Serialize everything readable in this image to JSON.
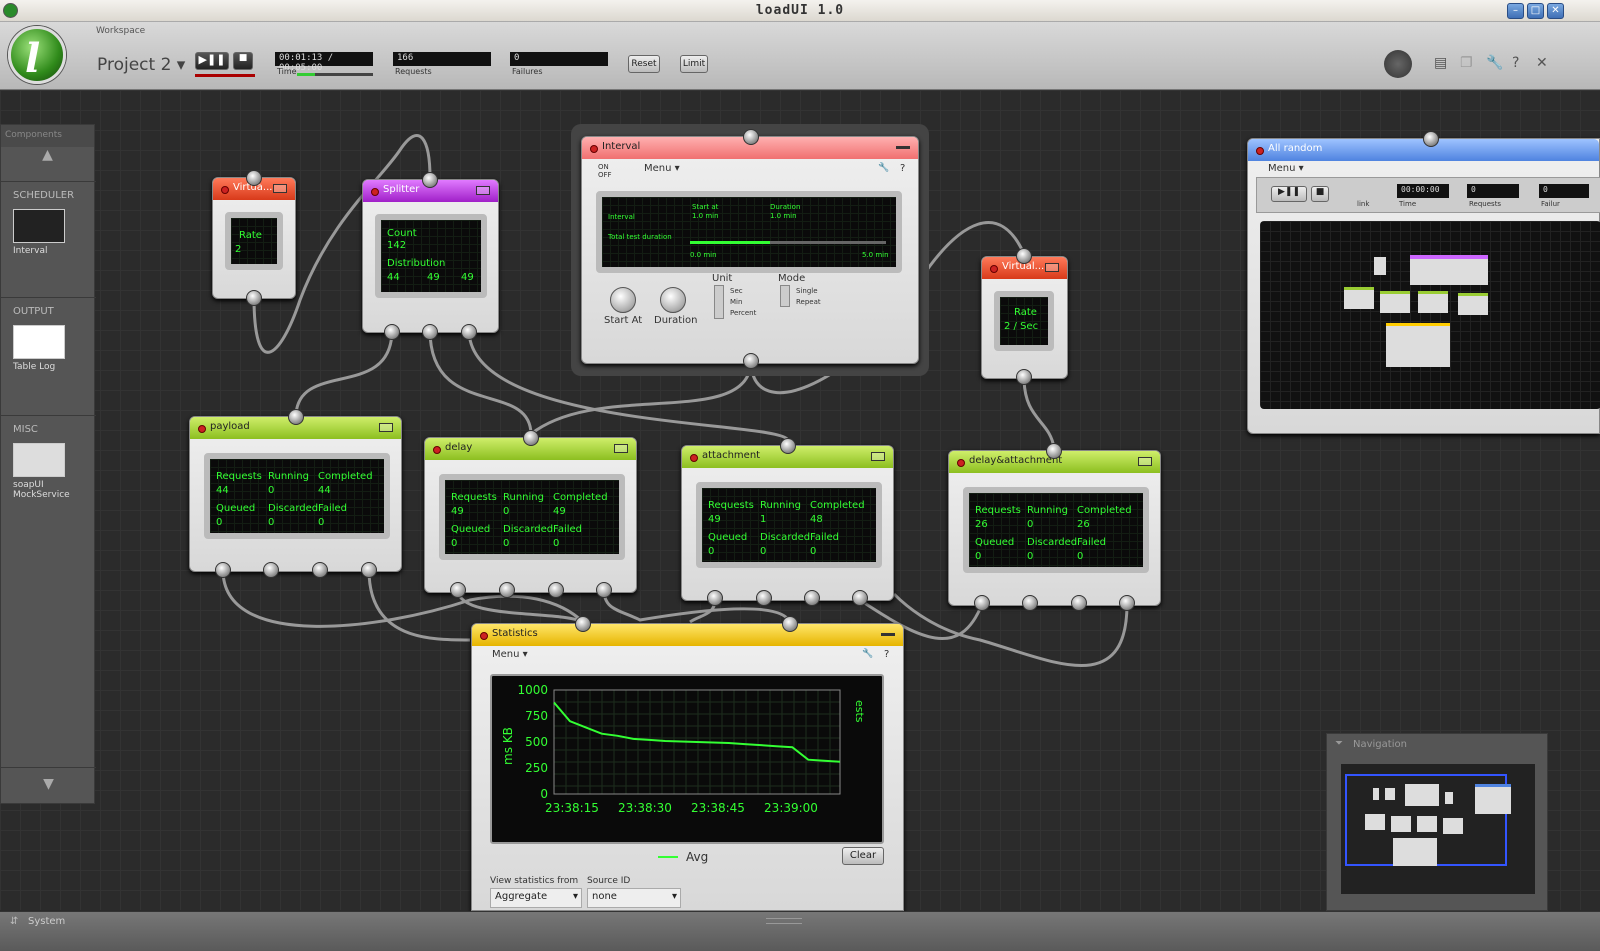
{
  "app": {
    "title": "loadUI 1.0",
    "workspace_label": "Workspace",
    "project_name": "Project 2"
  },
  "toolbar": {
    "time_value": "00:01:13 / 00:05:00",
    "time_label": "Time",
    "requests_value": "166",
    "requests_label": "Requests",
    "failures_value": "0",
    "failures_label": "Failures",
    "reset_label": "Reset",
    "limit_label": "Limit",
    "time_progress": 0.24
  },
  "sidebar": {
    "header": "Components",
    "sections": [
      {
        "title": "SCHEDULER",
        "item": "Interval"
      },
      {
        "title": "OUTPUT",
        "item": "Table Log"
      },
      {
        "title": "MISC",
        "item": "soapUI MockService"
      }
    ]
  },
  "nodes": {
    "virtual1": {
      "title": "Virtua...",
      "rate_label": "Rate",
      "rate_value": "2"
    },
    "splitter": {
      "title": "Splitter",
      "count_label": "Count",
      "count_value": "142",
      "dist_label": "Distribution",
      "d1": "44",
      "d2": "49",
      "d3": "49"
    },
    "interval": {
      "title": "Interval",
      "on": "ON",
      "off": "OFF",
      "menu": "Menu",
      "screen_interval": "Interval",
      "start_at_label": "Start at",
      "start_at_value": "1.0 min",
      "duration_label": "Duration",
      "duration_value": "1.0 min",
      "total_label": "Total test duration",
      "min_label": "0.0 min",
      "max_label": "5.0 min",
      "knob1": "Start At",
      "knob2": "Duration",
      "unit_label": "Unit",
      "unit_opts": [
        "Sec",
        "Min",
        "Percent"
      ],
      "mode_label": "Mode",
      "mode_opts": [
        "Single",
        "Repeat"
      ]
    },
    "virtual2": {
      "title": "Virtual...",
      "rate_label": "Rate",
      "rate_value": "2 / Sec"
    },
    "payload": {
      "title": "payload",
      "requests": "44",
      "running": "0",
      "completed": "44",
      "queued": "0",
      "discarded": "0",
      "failed": "0"
    },
    "delay": {
      "title": "delay",
      "requests": "49",
      "running": "0",
      "completed": "49",
      "queued": "0",
      "discarded": "0",
      "failed": "0"
    },
    "attachment": {
      "title": "attachment",
      "requests": "49",
      "running": "1",
      "completed": "48",
      "queued": "0",
      "discarded": "0",
      "failed": "0"
    },
    "delayatt": {
      "title": "delay&attachment",
      "requests": "26",
      "running": "0",
      "completed": "26",
      "queued": "0",
      "discarded": "0",
      "failed": "0"
    },
    "statistics": {
      "title": "Statistics",
      "menu": "Menu",
      "legend": "Avg",
      "clear": "Clear",
      "view_label": "View statistics from",
      "view_value": "Aggregate",
      "source_label": "Source ID",
      "source_value": "none",
      "right_label": "ests"
    },
    "allrandom": {
      "title": "All random",
      "menu": "Menu",
      "link": "link",
      "time_value": "00:00:00",
      "time_label": "Time",
      "requests_value": "0",
      "requests_label": "Requests",
      "failures_value": "0",
      "failures_label": "Failur"
    }
  },
  "labels": {
    "requests": "Requests",
    "running": "Running",
    "completed": "Completed",
    "queued": "Queued",
    "discarded": "Discarded",
    "failed": "Failed"
  },
  "navigation": {
    "title": "Navigation"
  },
  "system": {
    "label": "System"
  },
  "chart_data": {
    "type": "line",
    "x": [
      "23:38:15",
      "23:38:30",
      "23:38:45",
      "23:39:00"
    ],
    "xlabel": "",
    "ylabel": "ms KB",
    "ylim": [
      0,
      1000
    ],
    "yticks": [
      0,
      250,
      500,
      750,
      1000
    ],
    "series": [
      {
        "name": "Avg",
        "color": "#33ff33",
        "values": [
          880,
          700,
          640,
          580,
          560,
          530,
          520,
          510,
          505,
          500,
          495,
          490,
          480,
          470,
          460,
          450,
          330,
          320,
          310
        ]
      }
    ]
  }
}
